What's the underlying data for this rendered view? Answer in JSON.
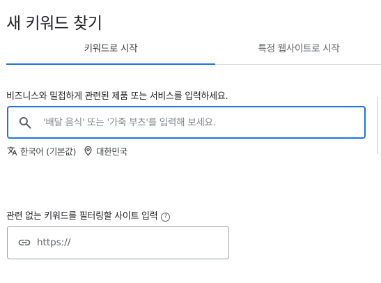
{
  "page": {
    "title": "새 키워드 찾기"
  },
  "tabs": [
    {
      "label": "키워드로 시작",
      "active": true
    },
    {
      "label": "특정 웹사이트로 시작",
      "active": false
    }
  ],
  "business_section": {
    "label": "비즈니스와 밀접하게 관련된 제품 또는 서비스를 입력하세요.",
    "search_icon": "search-icon",
    "search_placeholder": "'배달 음식' 또는 '가죽 부츠'를 입력해 보세요.",
    "search_value": ""
  },
  "targeting": {
    "language_icon": "translate-icon",
    "language": "한국어 (기본값)",
    "location_icon": "location-pin-icon",
    "location": "대한민국"
  },
  "filter_section": {
    "label": "관련 없는 키워드를 필터링할 사이트 입력",
    "help_icon": "help-icon",
    "help_glyph": "?",
    "link_icon": "link-icon",
    "url_placeholder": "https://",
    "url_value": ""
  },
  "colors": {
    "accent": "#1a73e8",
    "text": "#202124",
    "secondary_text": "#5f6368",
    "border": "#9aa0a6"
  }
}
